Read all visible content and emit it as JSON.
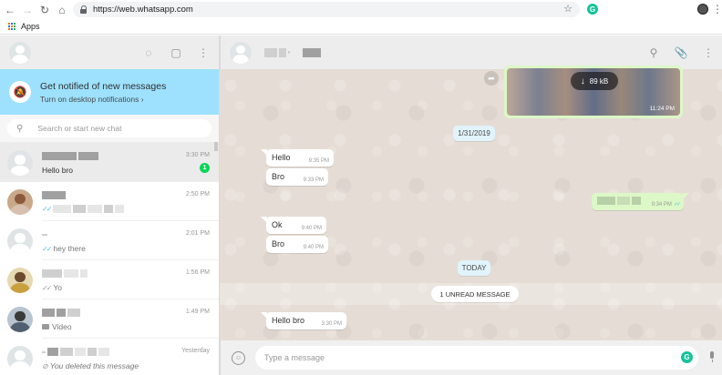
{
  "browser": {
    "url": "https://web.whatsapp.com",
    "bookmarks_label": "Apps",
    "extension_label": "G"
  },
  "sidebar": {
    "notification": {
      "title": "Get notified of new messages",
      "subtitle": "Turn on desktop notifications ›"
    },
    "search_placeholder": "Search or start new chat",
    "chats": [
      {
        "last": "Hello bro",
        "time": "3:30 PM",
        "unread": "1"
      },
      {
        "last": "",
        "time": "2:50 PM"
      },
      {
        "last": "hey there",
        "time": "2:01 PM"
      },
      {
        "last": "Yo",
        "time": "1:56 PM"
      },
      {
        "last": "Video",
        "time": "1:49 PM"
      },
      {
        "last": "You deleted this message",
        "time": "Yesterday"
      }
    ]
  },
  "conversation": {
    "media": {
      "size": "89 kB",
      "time": "11:24 PM"
    },
    "date_label": "1/31/2019",
    "today_label": "TODAY",
    "unread_label": "1 UNREAD MESSAGE",
    "messages": [
      {
        "text": "Hello",
        "time": "9:35 PM"
      },
      {
        "text": "Bro",
        "time": "9:33 PM"
      },
      {
        "text": "",
        "time": "9:34 PM"
      },
      {
        "text": "Ok",
        "time": "9:40 PM"
      },
      {
        "text": "Bro",
        "time": "9:40 PM"
      },
      {
        "text": "Hello bro",
        "time": "3:30 PM"
      }
    ],
    "composer_placeholder": "Type a message"
  },
  "colors": {
    "accent_green": "#06d755",
    "notification_bg": "#9de1fe",
    "outgoing_bubble": "#dcf8c6",
    "chat_bg": "#e5ddd5"
  },
  "icons": [
    "back-icon",
    "forward-icon",
    "reload-icon",
    "home-icon",
    "lock-icon",
    "star-icon",
    "status-icon",
    "new-chat-icon",
    "menu-icon",
    "bell-off-icon",
    "search-icon",
    "attach-icon",
    "emoji-icon",
    "mic-icon",
    "download-icon"
  ]
}
